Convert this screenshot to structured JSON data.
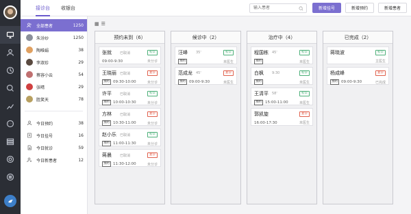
{
  "rail": {
    "icons": [
      "monitor-icon",
      "user-icon",
      "history-icon",
      "search-icon",
      "chart-icon",
      "chat-icon",
      "list-icon",
      "settings-icon",
      "list-alt-icon"
    ],
    "active_index": 0
  },
  "topbar": {
    "tabs": [
      {
        "label": "接诊台"
      },
      {
        "label": "收银台"
      }
    ],
    "search_placeholder": "输入患者",
    "btn_register": "新增挂号",
    "btn_appointment": "新增预约",
    "btn_new_patient": "新增患者"
  },
  "patients": {
    "all": {
      "label": "全部患者",
      "count": "1250"
    },
    "items": [
      {
        "name": "朱汾纱",
        "count": "1250",
        "color": "#8a8f9a"
      },
      {
        "name": "陶唯娟",
        "count": "38",
        "color": "#e0a060"
      },
      {
        "name": "李淑珍",
        "count": "29",
        "color": "#5a4a40"
      },
      {
        "name": "蔡容小云",
        "count": "54",
        "color": "#c07070"
      },
      {
        "name": "张晴",
        "count": "29",
        "color": "#d04040"
      },
      {
        "name": "胜笑天",
        "count": "78",
        "color": "#b8a060"
      }
    ],
    "stats": [
      {
        "label": "今日预约",
        "count": "38",
        "icon": "user-icon"
      },
      {
        "label": "今日挂号",
        "count": "16",
        "icon": "edit-icon"
      },
      {
        "label": "今日就诊",
        "count": "59",
        "icon": "doc-icon"
      },
      {
        "label": "今日新患者",
        "count": "12",
        "icon": "user-add-icon"
      }
    ]
  },
  "columns": [
    {
      "title": "预约未到（6）",
      "cards": [
        {
          "name": "张就",
          "sub": "已取消",
          "tag": "初诊",
          "tag_color": "#4caf78",
          "badge": "",
          "time": "09:00-9:30",
          "status": "未分诊"
        },
        {
          "name": "王晓丽",
          "sub": "已取消",
          "tag": "复诊",
          "tag_color": "#e0604c",
          "badge": "预约",
          "time": "09:30-10:00",
          "status": "未分诊"
        },
        {
          "name": "许平",
          "sub": "已取消",
          "tag": "初诊",
          "tag_color": "#4caf78",
          "badge": "预约",
          "time": "10:00-10:30",
          "status": "未分诊"
        },
        {
          "name": "方林",
          "sub": "已取消",
          "tag": "复诊",
          "tag_color": "#e0604c",
          "badge": "预约",
          "time": "10:30-11:00",
          "status": "未分诊"
        },
        {
          "name": "赵小乐",
          "sub": "已取消",
          "tag": "初诊",
          "tag_color": "#4caf78",
          "badge": "预约",
          "time": "11:00-11:30",
          "status": "未分诊"
        },
        {
          "name": "蒋晨",
          "sub": "已取消",
          "tag": "复诊",
          "tag_color": "#e0604c",
          "badge": "预约",
          "time": "11:30-12:00",
          "status": "未分诊"
        }
      ]
    },
    {
      "title": "候诊中（2）",
      "cards": [
        {
          "name": "汪峰",
          "sub": "35'",
          "tag": "初诊",
          "tag_color": "#4caf78",
          "badge": "预约",
          "time": "",
          "status": "未医生"
        },
        {
          "name": "范成龙",
          "sub": "45'",
          "tag": "复诊",
          "tag_color": "#e0604c",
          "badge": "预约",
          "time": "09:00-9:30",
          "status": "未医生"
        }
      ]
    },
    {
      "title": "治疗中（4）",
      "cards": [
        {
          "name": "程国栋",
          "sub": "45'",
          "tag": "初诊",
          "tag_color": "#4caf78",
          "badge": "预约",
          "time": "",
          "status": "未医生"
        },
        {
          "name": "白枫",
          "sub": "9:30",
          "tag": "初诊",
          "tag_color": "#4caf78",
          "badge": "预约",
          "time": "",
          "status": "未医生"
        },
        {
          "name": "王清平",
          "sub": "58'",
          "tag": "初诊",
          "tag_color": "#4caf78",
          "badge": "预约",
          "time": "15:00-11:00",
          "status": "未医生"
        },
        {
          "name": "郭凯旋",
          "sub": "",
          "tag": "复诊",
          "tag_color": "#e0604c",
          "badge": "",
          "time": "16:00-17:30",
          "status": "未医生"
        }
      ]
    },
    {
      "title": "已完成（2）",
      "cards": [
        {
          "name": "蒋晓波",
          "sub": "",
          "tag": "初诊",
          "tag_color": "#4caf78",
          "badge": "",
          "time": "",
          "status": "主医生"
        },
        {
          "name": "杨成峰",
          "sub": "",
          "tag": "复诊",
          "tag_color": "#e0604c",
          "badge": "预约",
          "time": "09:00-9:30",
          "status": "已完成"
        }
      ]
    }
  ],
  "colors": {
    "accent": "#7b6fd0",
    "rail": "#2b2e35"
  }
}
